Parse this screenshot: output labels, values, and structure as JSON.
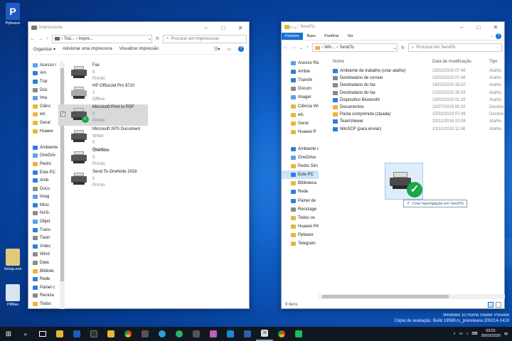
{
  "desktop": {
    "icons": [
      {
        "label": "Ppliware",
        "color": "#1f5ac0"
      },
      {
        "label": "Setup.exe",
        "color": "#e4c87a"
      },
      {
        "label": "Plifilas",
        "color": "#d8e4f0"
      }
    ],
    "watermark": {
      "line1": "Windows 10 Home Insider Preview",
      "line2": "Cópia de avaliação. Build 19569.rs_prerelease.200214-1419"
    }
  },
  "left_window": {
    "title": "Impressoras",
    "address": [
      "Tod...",
      "Impre..."
    ],
    "search_placeholder": "Procurar em Impressoras",
    "commands": [
      "Organizar ▾",
      "Adicionar uma impressora",
      "Visualizar impressão"
    ],
    "nav": [
      {
        "label": "Acesso r",
        "icon": "star-icon",
        "color": "lb"
      },
      {
        "label": "Am",
        "icon": "desktop-icon",
        "color": "b"
      },
      {
        "label": "Trar",
        "icon": "download-icon",
        "color": "b"
      },
      {
        "label": "Doc",
        "icon": "doc-icon",
        "color": "g"
      },
      {
        "label": "Ima",
        "icon": "image-icon",
        "color": "lb"
      },
      {
        "label": "Ciênc",
        "icon": "folder-icon",
        "color": "y"
      },
      {
        "label": "etc",
        "icon": "folder-icon",
        "color": "y"
      },
      {
        "label": "Geral",
        "icon": "folder-icon",
        "color": "y"
      },
      {
        "label": "Huawe",
        "icon": "folder-icon",
        "color": "y"
      },
      {
        "label": "",
        "icon": "none",
        "color": ""
      },
      {
        "label": "Ambiente",
        "icon": "desktop-icon",
        "color": "b"
      },
      {
        "label": "OneDriv",
        "icon": "cloud-icon",
        "color": "lb"
      },
      {
        "label": "Pedro",
        "icon": "user-icon",
        "color": "y"
      },
      {
        "label": "Este PC",
        "icon": "pc-icon",
        "color": "b"
      },
      {
        "label": "Amb",
        "icon": "desktop-icon",
        "color": "b"
      },
      {
        "label": "Docu",
        "icon": "doc-icon",
        "color": "g"
      },
      {
        "label": "Imag",
        "icon": "image-icon",
        "color": "lb"
      },
      {
        "label": "Músi",
        "icon": "music-icon",
        "color": "b"
      },
      {
        "label": "NAS-",
        "icon": "drive-icon",
        "color": "g"
      },
      {
        "label": "Objet",
        "icon": "cube-icon",
        "color": "lb"
      },
      {
        "label": "Trans",
        "icon": "download-icon",
        "color": "b"
      },
      {
        "label": "Twon",
        "icon": "drive-icon",
        "color": "g"
      },
      {
        "label": "Vídec",
        "icon": "video-icon",
        "color": "b"
      },
      {
        "label": "Wind",
        "icon": "drive-icon",
        "color": "g"
      },
      {
        "label": "Data",
        "icon": "drive-icon",
        "color": "g"
      },
      {
        "label": "Bibliote",
        "icon": "library-icon",
        "color": "y"
      },
      {
        "label": "Rede",
        "icon": "network-icon",
        "color": "b"
      },
      {
        "label": "Painel c",
        "icon": "panel-icon",
        "color": "b"
      },
      {
        "label": "Recicla",
        "icon": "recycle-icon",
        "color": "g"
      },
      {
        "label": "Todos",
        "icon": "folder-icon",
        "color": "y"
      }
    ],
    "printers": [
      {
        "name": "Fax",
        "l2": "0",
        "l3": "Pronto",
        "light": false,
        "check": false
      },
      {
        "name": "HP OfficeJet Pro 8710",
        "l2": "1",
        "l3": "Offline",
        "light": true,
        "check": false
      },
      {
        "name": "Microsoft Print to PDF",
        "l2": "0",
        "l3": "Pronto",
        "light": false,
        "check": true
      },
      {
        "name": "Microsoft XPS Document",
        "l2": "Writer",
        "l3": "0",
        "l4": "Pronto",
        "light": false,
        "check": false
      },
      {
        "name": "OneNote",
        "l2": "0",
        "l3": "Pronto",
        "light": false,
        "check": false
      },
      {
        "name": "Send To OneNote 2016",
        "l2": "0",
        "l3": "Pronto",
        "light": false,
        "check": false
      }
    ]
  },
  "right_window": {
    "title": "SendTo",
    "ribbon_tabs": [
      "Ficheiro",
      "Base",
      "Partilhar",
      "Ver"
    ],
    "address": [
      "Win...",
      "SendTo"
    ],
    "search_placeholder": "Procurar em SendTo",
    "columns": [
      "Nome",
      "Data de modificação",
      "Tipo"
    ],
    "files": [
      {
        "name": "Ambiente de trabalho (criar atalho)",
        "date": "15/02/2020 07:46",
        "type": "Atalho",
        "color": "b"
      },
      {
        "name": "Destinatário de correio",
        "date": "15/02/2020 07:46",
        "type": "Atalho",
        "color": "g"
      },
      {
        "name": "Destinatário do fax",
        "date": "18/02/2020 18:10",
        "type": "Atalho",
        "color": "g"
      },
      {
        "name": "Destinatário do fax",
        "date": "21/02/2020 20:33",
        "type": "Atalho",
        "color": "g"
      },
      {
        "name": "Dispositivo Bluetooth",
        "date": "15/02/2020 01:32",
        "type": "Atalho",
        "color": "b"
      },
      {
        "name": "Documentos",
        "date": "22/07/2019 00:32",
        "type": "Destino",
        "color": "y"
      },
      {
        "name": "Pasta comprimida (zipada)",
        "date": "15/02/2020 07:46",
        "type": "Destino",
        "color": "y"
      },
      {
        "name": "TeamViewer",
        "date": "20/12/2019 13:08",
        "type": "Atalho",
        "color": "b"
      },
      {
        "name": "WinSCP (para enviar)",
        "date": "10/12/2019 11:08",
        "type": "Atalho",
        "color": "b"
      }
    ],
    "nav": [
      {
        "label": "Acesso Rápi",
        "color": "lb"
      },
      {
        "label": "Ambie",
        "color": "b"
      },
      {
        "label": "Transfe",
        "color": "b"
      },
      {
        "label": "Docum",
        "color": "g"
      },
      {
        "label": "Imager",
        "color": "lb"
      },
      {
        "label": "Ciência Wi",
        "color": "y"
      },
      {
        "label": "etc",
        "color": "y"
      },
      {
        "label": "Geral",
        "color": "y"
      },
      {
        "label": "Huawei P",
        "color": "y"
      },
      {
        "label": "",
        "color": ""
      },
      {
        "label": "Ambiente d",
        "color": "b"
      },
      {
        "label": "OneDrive",
        "color": "lb"
      },
      {
        "label": "Pedro Sim",
        "color": "y"
      },
      {
        "label": "Este PC",
        "color": "b"
      },
      {
        "label": "Biblioteca",
        "color": "y"
      },
      {
        "label": "Rede",
        "color": "b"
      },
      {
        "label": "Painel de",
        "color": "b"
      },
      {
        "label": "Reciclage",
        "color": "g"
      },
      {
        "label": "Todos os",
        "color": "y"
      },
      {
        "label": "Huawei P4",
        "color": "y"
      },
      {
        "label": "Pplware",
        "color": "y"
      },
      {
        "label": "Telegram",
        "color": "y"
      }
    ],
    "status": "9 itens",
    "drag_tooltip": "Criar hiperligação em SendTo"
  },
  "taskbar": {
    "time": "03:01",
    "date": "26/03/2020",
    "badge": "38"
  },
  "colors": {
    "accent": "#0078d7",
    "check_green": "#17a84a"
  }
}
